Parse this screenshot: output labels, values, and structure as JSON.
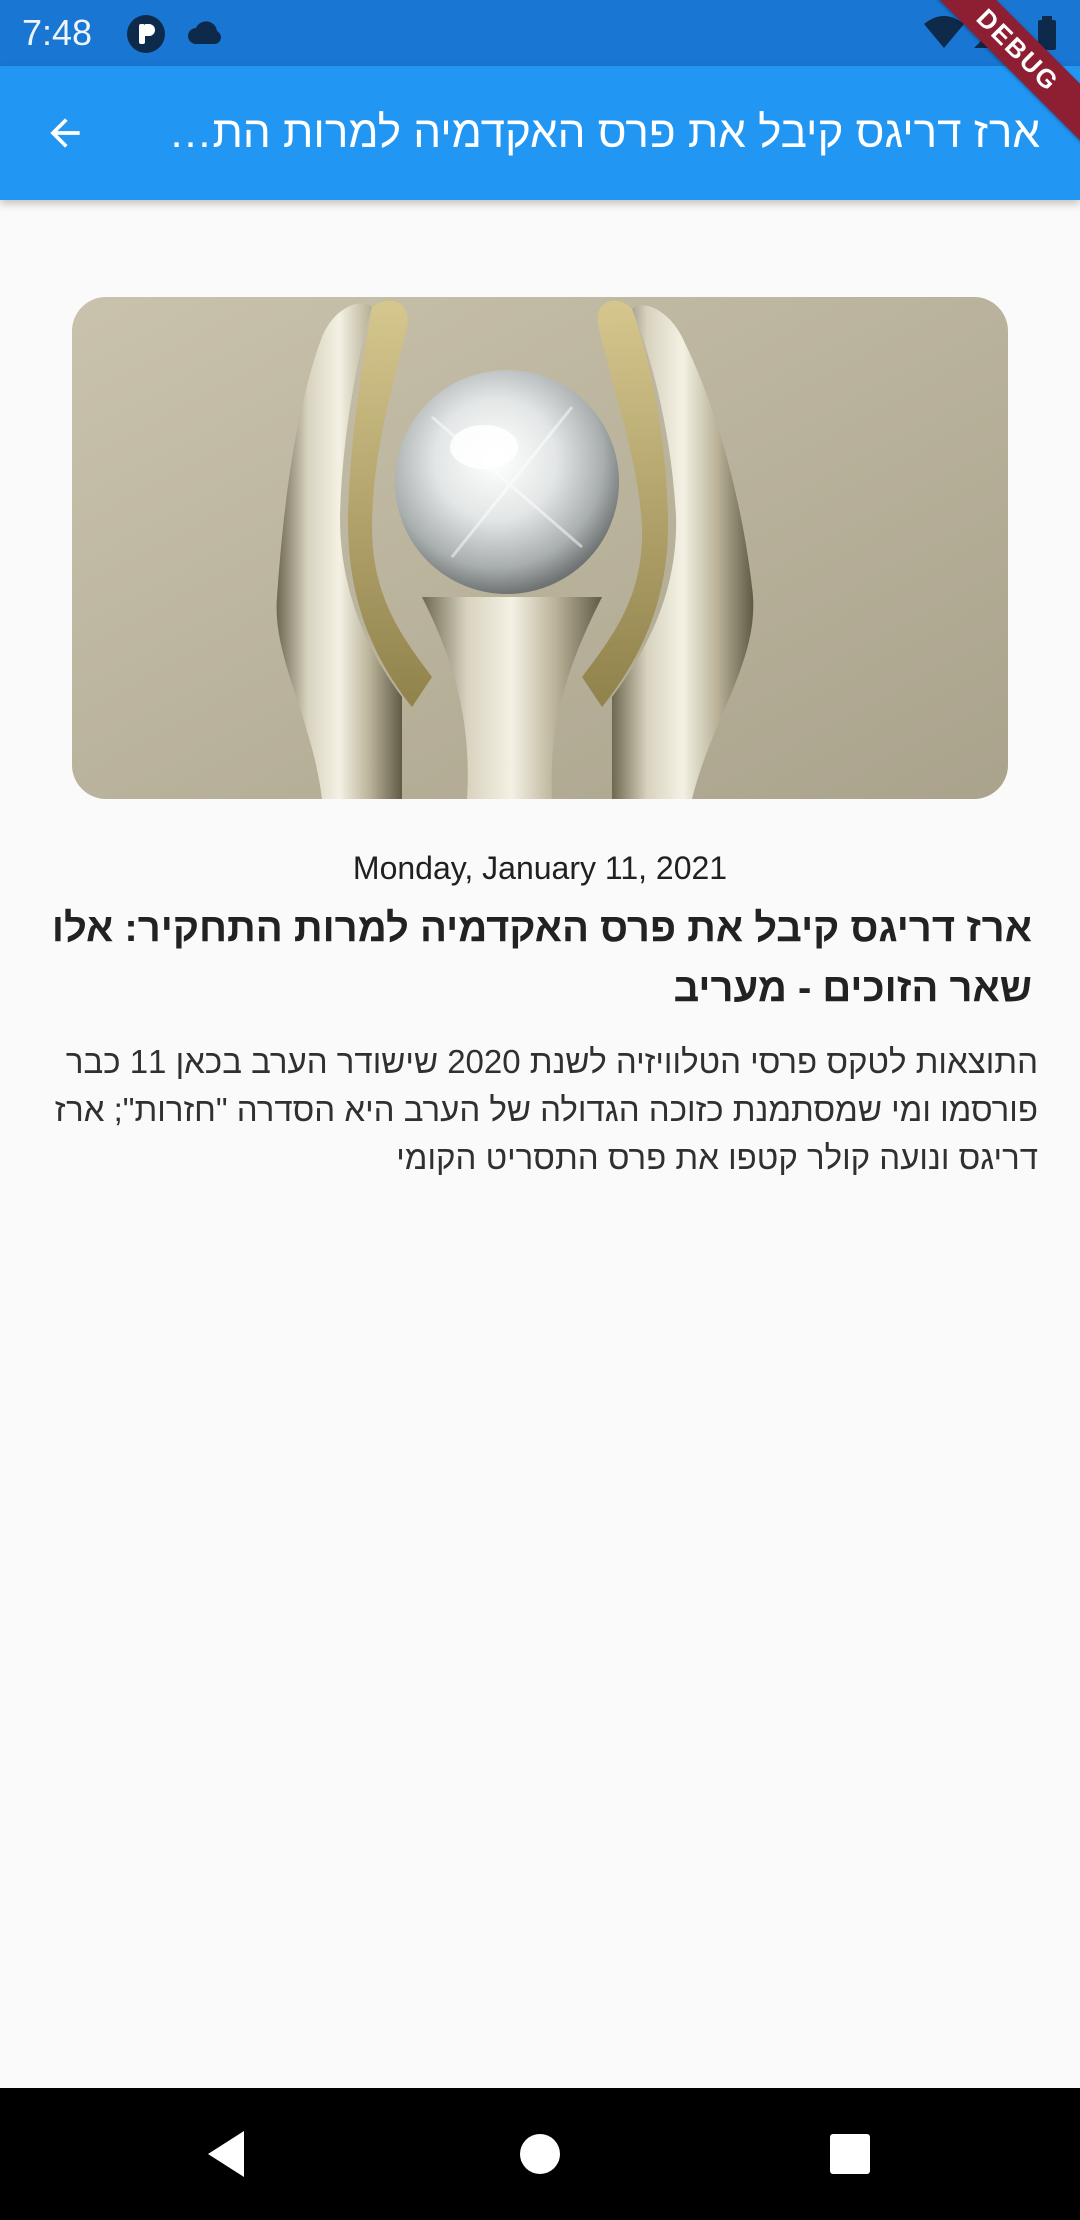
{
  "status_bar": {
    "time": "7:48",
    "icons": [
      "app-notification-icon",
      "cloud-icon",
      "wifi-icon",
      "cell-signal-icon",
      "battery-icon"
    ]
  },
  "app_bar": {
    "back_icon": "arrow-back-icon",
    "title": "ארז דריגס קיבל את פרס האקדמיה למרות התחקיר: אלו שאר הזוכים - מעריב",
    "debug_banner": "DEBUG"
  },
  "article": {
    "image": "award-statuette-hands-holding-crystal-sphere",
    "date": "Monday, January 11, 2021",
    "headline": "ארז דריגס קיבל את פרס האקדמיה למרות התחקיר: אלו שאר הזוכים - מעריב",
    "summary": "התוצאות לטקס פרסי הטלוויזיה לשנת 2020 שישודר הערב בכאן 11 כבר פורסמו ומי שמסתמנת כזוכה הגדולה של הערב היא הסדרה \"חזרות\"; ארז דריגס ונועה קולר קטפו את פרס התסריט הקומי"
  },
  "nav_bar": {
    "back": "nav-back-icon",
    "home": "nav-home-icon",
    "recents": "nav-recents-icon"
  },
  "colors": {
    "status_bar": "#1976d2",
    "app_bar": "#2196f3",
    "debug_ribbon": "#8e1f33",
    "background": "#fafafa",
    "nav_bar": "#000000"
  }
}
